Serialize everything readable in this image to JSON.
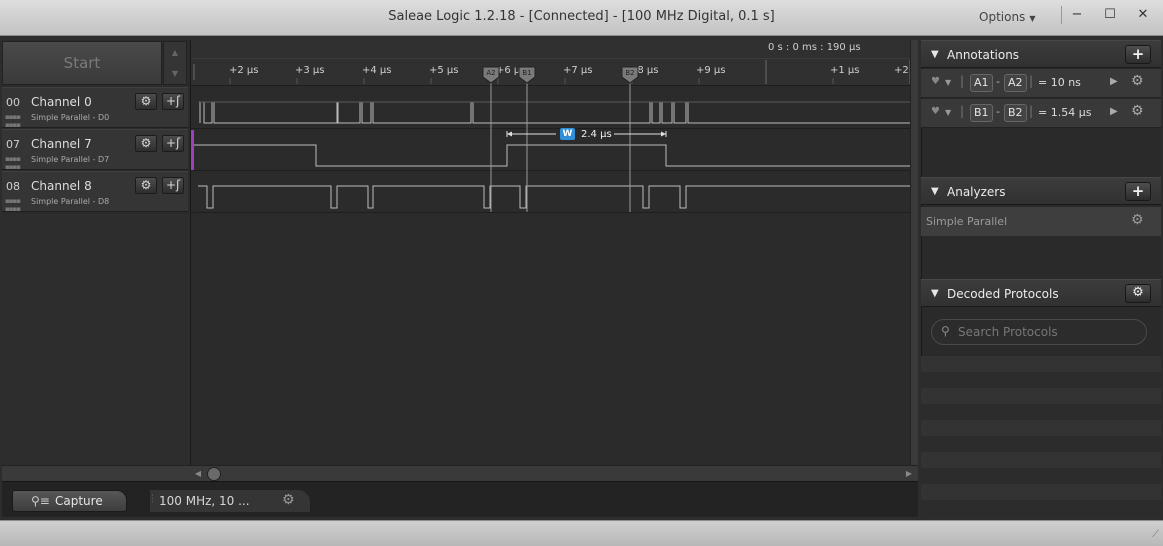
{
  "window": {
    "title": "Saleae Logic 1.2.18 - [Connected] - [100 MHz Digital, 0.1 s]",
    "options_label": "Options",
    "buttons": {
      "minimize": "−",
      "maximize": "☐",
      "close": "✕"
    }
  },
  "left": {
    "start_label": "Start",
    "channels": [
      {
        "num": "00",
        "name": "Channel 0",
        "sub": "Simple Parallel - D0"
      },
      {
        "num": "07",
        "name": "Channel 7",
        "sub": "Simple Parallel - D7"
      },
      {
        "num": "08",
        "name": "Channel 8",
        "sub": "Simple Parallel - D8"
      }
    ]
  },
  "timeline": {
    "absolute_time": "0 s : 0 ms : 190 µs",
    "ticks": [
      "+2 µs",
      "+3 µs",
      "+4 µs",
      "+5 µs",
      "+6 µs",
      "+7 µs",
      "+8 µs",
      "+9 µs",
      "+1 µs",
      "+2"
    ],
    "markers": [
      "A2",
      "B1",
      "B2"
    ],
    "measurement_badge": "W",
    "measurement_value": "2.4 µs"
  },
  "bottom": {
    "capture_label": "Capture",
    "rate_label": "100 MHz, 10 ..."
  },
  "annotations": {
    "header": "Annotations",
    "rows": [
      {
        "m1": "A1",
        "m2": "A2",
        "value": "= 10 ns"
      },
      {
        "m1": "B1",
        "m2": "B2",
        "value": "= 1.54 µs"
      }
    ]
  },
  "analyzers": {
    "header": "Analyzers",
    "items": [
      "Simple Parallel"
    ]
  },
  "decoded": {
    "header": "Decoded Protocols",
    "search_placeholder": "Search Protocols"
  },
  "colors": {
    "wave": "#bdbdbd",
    "marker_line": "#9a9a9a",
    "trigger": "#a040c0",
    "badge": "#2f8fd8"
  }
}
